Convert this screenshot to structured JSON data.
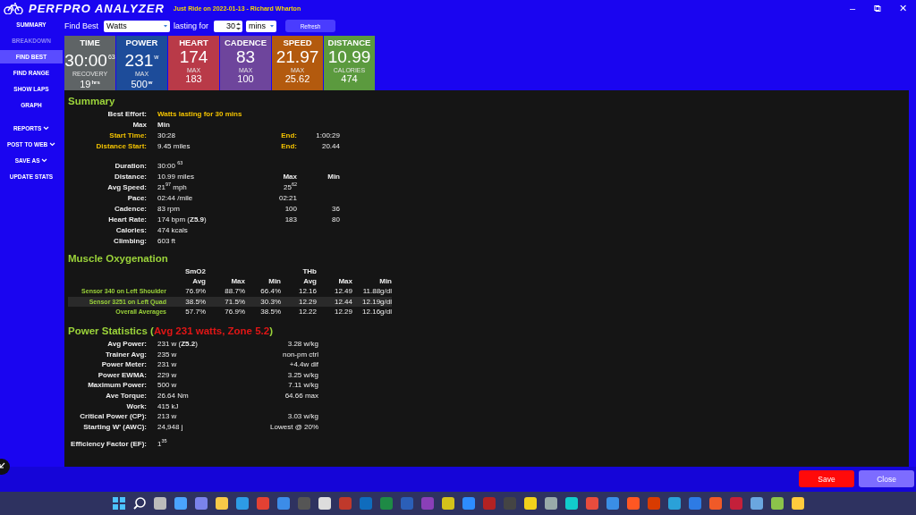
{
  "window": {
    "app_name": "PERFPRO ANALYZER",
    "ride_title": "Just Ride on 2022-01-13 - Richard Wharton",
    "controls": [
      "–",
      "⧉",
      "✕"
    ]
  },
  "sidebar": {
    "items": [
      {
        "label": "SUMMARY",
        "selected": false,
        "disabled": false,
        "has_menu": false
      },
      {
        "label": "BREAKDOWN",
        "selected": false,
        "disabled": true,
        "has_menu": false
      },
      {
        "label": "FIND BEST",
        "selected": true,
        "disabled": false,
        "has_menu": false
      },
      {
        "label": "FIND RANGE",
        "selected": false,
        "disabled": false,
        "has_menu": false
      },
      {
        "label": "SHOW LAPS",
        "selected": false,
        "disabled": false,
        "has_menu": false
      },
      {
        "label": "GRAPH",
        "selected": false,
        "disabled": false,
        "has_menu": false
      },
      {
        "label": "REPORTS",
        "selected": false,
        "disabled": false,
        "has_menu": true
      },
      {
        "label": "POST TO WEB",
        "selected": false,
        "disabled": false,
        "has_menu": true
      },
      {
        "label": "SAVE AS",
        "selected": false,
        "disabled": false,
        "has_menu": true
      },
      {
        "label": "UPDATE STATS",
        "selected": false,
        "disabled": false,
        "has_menu": false
      }
    ]
  },
  "find_best": {
    "label": "Find Best",
    "metric": "Watts",
    "duration_label": "lasting for",
    "duration": "30",
    "unit": "mins",
    "refresh": "Refresh"
  },
  "tiles": [
    {
      "title": "TIME",
      "value": "30:00",
      "value_unit": "63",
      "sub_label": "RECOVERY",
      "sub_value": "19",
      "sub_unit": "hrs",
      "color": "#5f6466"
    },
    {
      "title": "POWER",
      "value": "231",
      "value_unit": "w",
      "sub_label": "MAX",
      "sub_value": "500",
      "sub_unit": "w",
      "color": "#1d4c9a"
    },
    {
      "title": "HEART",
      "value": "174",
      "sub_label": "MAX",
      "sub_value": "183",
      "color": "#b93a48"
    },
    {
      "title": "CADENCE",
      "value": "83",
      "sub_label": "MAX",
      "sub_value": "100",
      "color": "#6e459c"
    },
    {
      "title": "SPEED",
      "value": "21.97",
      "sub_label": "MAX",
      "sub_value": "25.62",
      "color": "#b35a0e"
    },
    {
      "title": "DISTANCE",
      "value": "10.99",
      "sub_label": "CALORIES",
      "sub_value": "474",
      "color": "#5b9a3e"
    }
  ],
  "summary": {
    "title": "Summary",
    "rows": [
      {
        "kind": "effort",
        "label": "Best Effort:",
        "value": "Watts lasting for 30 mins"
      },
      {
        "kind": "header",
        "label": "Max",
        "value": "Min"
      },
      {
        "kind": "range",
        "label": "Start Time:",
        "value": "30:28",
        "col_3": "End:",
        "col_4": "1:00:29"
      },
      {
        "kind": "range",
        "label": "Distance Start:",
        "value": "9.45 miles",
        "col_3": "End:",
        "col_4": "20.44"
      },
      {
        "kind": "gap"
      },
      {
        "kind": "stat",
        "label": "Duration:",
        "value": "30:00 $^{63}$"
      },
      {
        "kind": "stat",
        "label": "Distance:",
        "value": "10.99 miles",
        "col_3": "Max",
        "col_4": "Min"
      },
      {
        "kind": "stat",
        "label": "Avg Speed:",
        "value": "21$^{97}$ mph",
        "col_3": "25$^{62}$"
      },
      {
        "kind": "stat",
        "label": "Pace:",
        "value": "02:44 /mile",
        "col_3": "02:21"
      },
      {
        "kind": "stat",
        "label": "Cadence:",
        "value": "83 rpm",
        "col_3": "100",
        "col_4": "36"
      },
      {
        "kind": "stat",
        "label": "Heart Rate:",
        "value": "174 bpm (**Z5.9**)",
        "col_3": "183",
        "col_4": "80"
      },
      {
        "kind": "stat",
        "label": "Calories:",
        "value": "474 kcals"
      },
      {
        "kind": "stat",
        "label": "Climbing:",
        "value": "603 ft"
      }
    ]
  },
  "muscle_oxygenation": {
    "title": "Muscle Oxygenation",
    "groups": [
      "SmO2",
      "THb"
    ],
    "columns": [
      "Avg",
      "Max",
      "Min",
      "Avg",
      "Max",
      "Min"
    ],
    "rows": [
      {
        "label": "Sensor 340 on Left Shoulder",
        "selected": false,
        "values": [
          "76.9%",
          "88.7%",
          "66.4%",
          "12.16",
          "12.49",
          "11.88g/dl"
        ]
      },
      {
        "label": "Sensor 3251 on Left Quad",
        "selected": true,
        "values": [
          "38.5%",
          "71.5%",
          "30.3%",
          "12.29",
          "12.44",
          "12.19g/dl"
        ]
      },
      {
        "label": "Overall Averages",
        "selected": false,
        "values": [
          "57.7%",
          "76.9%",
          "38.5%",
          "12.22",
          "12.29",
          "12.16g/dl"
        ]
      }
    ]
  },
  "power_statistics": {
    "title": "Power Statistics (",
    "note": "Avg 231 watts, Zone 5.2",
    "title_end": ")",
    "rows": [
      {
        "label": "Avg Power:",
        "value": "231 w (**Z5.2**)",
        "col_3": "3.28 w/kg"
      },
      {
        "label": "Trainer Avg:",
        "value": "235 w",
        "col_3": "non-pm ctrl"
      },
      {
        "label": "Power Meter:",
        "value": "231 w",
        "col_3": "+4.4w dif"
      },
      {
        "label": "Power EWMA:",
        "value": "229 w",
        "col_3": "3.25 w/kg"
      },
      {
        "label": "Maximum Power:",
        "value": "500 w",
        "col_3": "7.11 w/kg"
      },
      {
        "label": "Ave Torque:",
        "value": "26.64 Nm",
        "col_3": "64.66 max"
      },
      {
        "label": "Work:",
        "value": "415 kJ"
      },
      {
        "label": "Critical Power (CP):",
        "value": "213 w",
        "col_3": "3.03 w/kg"
      },
      {
        "label": "Starting W' (AWC):",
        "value": "24,948 j",
        "col_3": "Lowest @ 20%"
      },
      {
        "label": "Efficiency Factor (EF):",
        "value": "1$^{35}$",
        "gap_before": true
      }
    ]
  },
  "buttons": [
    {
      "label": "Save",
      "kind": "primary"
    },
    {
      "label": "Close",
      "kind": "secondary"
    }
  ]
}
